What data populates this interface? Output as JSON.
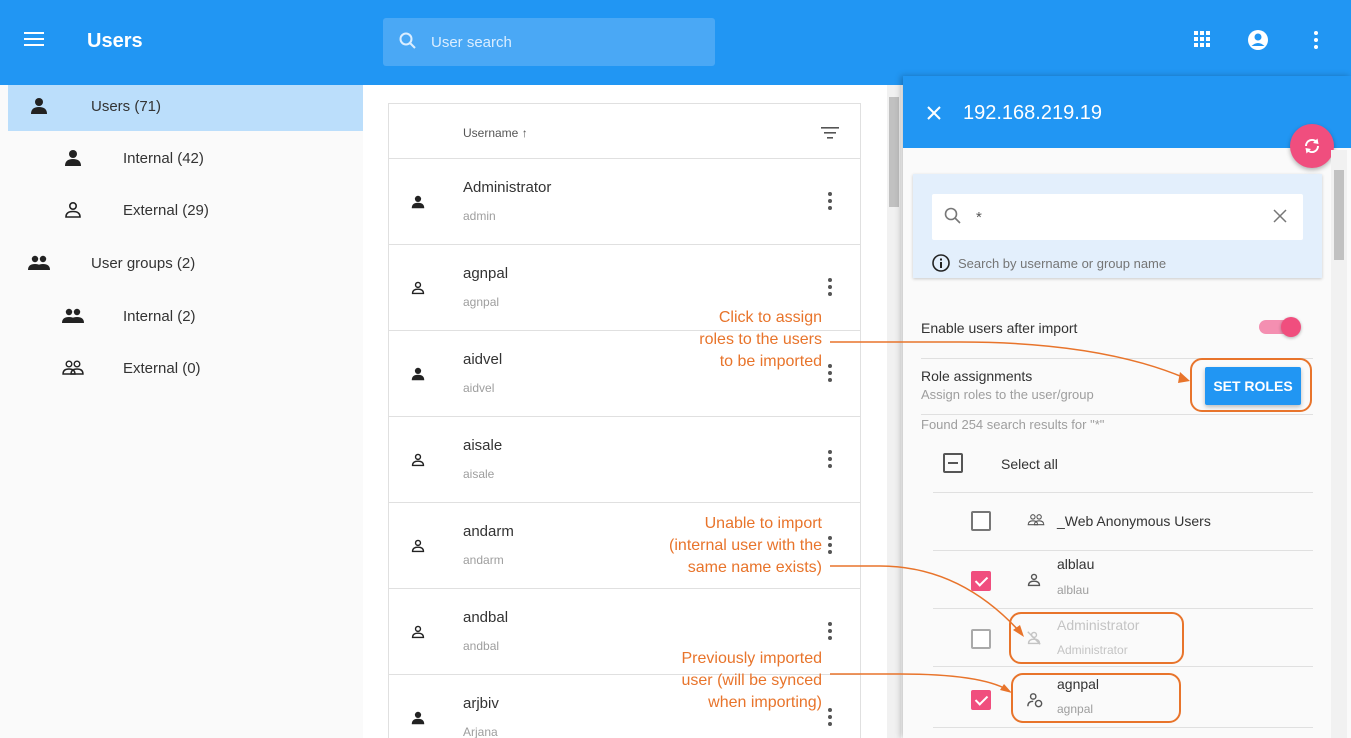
{
  "header": {
    "title": "Users",
    "search_placeholder": "User search"
  },
  "sidebar": {
    "items": [
      {
        "label": "Users (71)"
      },
      {
        "label": "Internal (42)"
      },
      {
        "label": "External (29)"
      },
      {
        "label": "User groups (2)"
      },
      {
        "label": "Internal (2)"
      },
      {
        "label": "External (0)"
      }
    ]
  },
  "list": {
    "column_header": "Username",
    "rows": [
      {
        "name": "Administrator",
        "sub": "admin"
      },
      {
        "name": "agnpal",
        "sub": "agnpal"
      },
      {
        "name": "aidvel",
        "sub": "aidvel"
      },
      {
        "name": "aisale",
        "sub": "aisale"
      },
      {
        "name": "andarm",
        "sub": "andarm"
      },
      {
        "name": "andbal",
        "sub": "andbal"
      },
      {
        "name": "arjbiv",
        "sub": "Arjana"
      }
    ]
  },
  "panel": {
    "title": "192.168.219.19",
    "search_value": "*",
    "hint": "Search by username or group name",
    "enable_label": "Enable users after import",
    "role_title": "Role assignments",
    "role_sub": "Assign roles to the user/group",
    "set_roles": "SET ROLES",
    "found": "Found 254 search results for \"*\"",
    "select_all": "Select all",
    "items": [
      {
        "name": "_Web Anonymous Users",
        "sub": ""
      },
      {
        "name": "alblau",
        "sub": "alblau"
      },
      {
        "name": "Administrator",
        "sub": "Administrator"
      },
      {
        "name": "agnpal",
        "sub": "agnpal"
      }
    ]
  },
  "callouts": {
    "set_roles": [
      "Click to assign",
      "roles to the users",
      "to be imported"
    ],
    "unable": [
      "Unable to import",
      "(internal user with the",
      "same name exists)"
    ],
    "previously": [
      "Previously imported",
      "user (will be synced",
      "when importing)"
    ]
  },
  "colors": {
    "primary": "#2196f3",
    "accent": "#f04e7e",
    "callout": "#e8742b",
    "active_nav": "#bbdefb"
  }
}
